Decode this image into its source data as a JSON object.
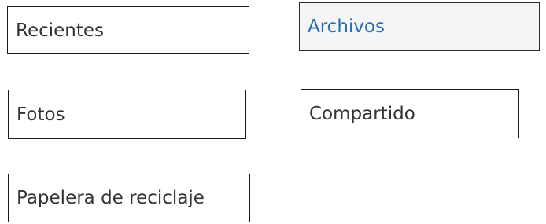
{
  "nav": {
    "items": [
      {
        "label": "Recientes",
        "selected": false
      },
      {
        "label": "Archivos",
        "selected": true
      },
      {
        "label": "Fotos",
        "selected": false
      },
      {
        "label": "Compartido",
        "selected": false
      },
      {
        "label": "Papelera de reciclaje",
        "selected": false
      }
    ]
  },
  "colors": {
    "selected_text": "#2a6cb0",
    "selected_background": "#f4f5f7",
    "text": "#333333",
    "border": "#1a1a1a"
  }
}
